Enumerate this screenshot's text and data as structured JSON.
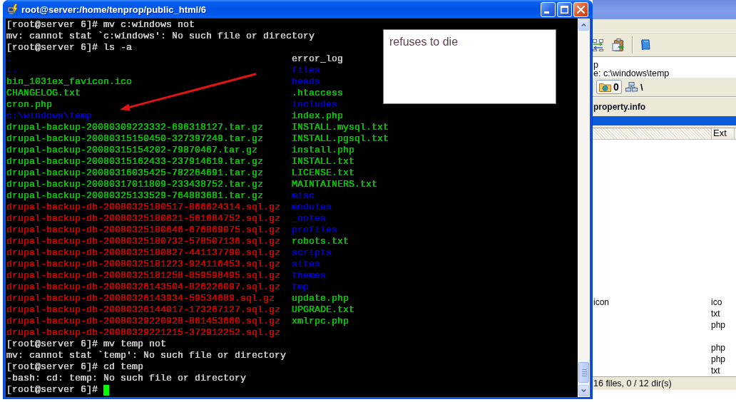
{
  "terminal": {
    "title": "root@server:/home/tenprop/public_html/6",
    "lines": [
      {
        "kind": "text",
        "text": "[root@server 6]# mv c:windows not",
        "cursor": false
      },
      {
        "kind": "text",
        "text": "mv: cannot stat `c:windows': No such file or directory",
        "cursor": false
      },
      {
        "kind": "text",
        "text": "[root@server 6]# ls -a",
        "cursor": false
      },
      {
        "kind": "listing",
        "entries": [
          {
            "text": ".",
            "color": "#0000c8"
          },
          {
            "text": "error_log",
            "color": "#c0c0c0"
          }
        ]
      },
      {
        "kind": "listing",
        "entries": [
          {
            "text": "..",
            "color": "#0000c8"
          },
          {
            "text": "files",
            "color": "#0000c8"
          }
        ]
      },
      {
        "kind": "listing",
        "entries": [
          {
            "text": "bin_1031ex_favicon.ico",
            "color": "#00c000"
          },
          {
            "text": "heads",
            "color": "#0000c8"
          }
        ]
      },
      {
        "kind": "listing",
        "entries": [
          {
            "text": "CHANGELOG.txt",
            "color": "#00c000"
          },
          {
            "text": ".htaccess",
            "color": "#00c000"
          }
        ]
      },
      {
        "kind": "listing",
        "entries": [
          {
            "text": "cron.php",
            "color": "#00c000"
          },
          {
            "text": "includes",
            "color": "#0000c8"
          }
        ]
      },
      {
        "kind": "listing",
        "entries": [
          {
            "text": "c:\\windows\\temp",
            "color": "#0000c8"
          },
          {
            "text": "index.php",
            "color": "#00c000"
          }
        ]
      },
      {
        "kind": "listing",
        "entries": [
          {
            "text": "drupal-backup-20080309223332-696318127.tar.gz",
            "color": "#00c000"
          },
          {
            "text": "INSTALL.mysql.txt",
            "color": "#00c000"
          }
        ]
      },
      {
        "kind": "listing",
        "entries": [
          {
            "text": "drupal-backup-20080315150450-327397249.tar.gz",
            "color": "#00c000"
          },
          {
            "text": "INSTALL.pgsql.txt",
            "color": "#00c000"
          }
        ]
      },
      {
        "kind": "listing",
        "entries": [
          {
            "text": "drupal-backup-20080315154202-79870467.tar.gz",
            "color": "#00c000"
          },
          {
            "text": "install.php",
            "color": "#00c000"
          }
        ]
      },
      {
        "kind": "listing",
        "entries": [
          {
            "text": "drupal-backup-20080315162433-237914619.tar.gz",
            "color": "#00c000"
          },
          {
            "text": "INSTALL.txt",
            "color": "#00c000"
          }
        ]
      },
      {
        "kind": "listing",
        "entries": [
          {
            "text": "drupal-backup-20080316035425-782264691.tar.gz",
            "color": "#00c000"
          },
          {
            "text": "LICENSE.txt",
            "color": "#00c000"
          }
        ]
      },
      {
        "kind": "listing",
        "entries": [
          {
            "text": "drupal-backup-20080317011809-233438752.tar.gz",
            "color": "#00c000"
          },
          {
            "text": "MAINTAINERS.txt",
            "color": "#00c000"
          }
        ]
      },
      {
        "kind": "listing",
        "entries": [
          {
            "text": "drupal-backup-20080325133529-764883681.tar.gz",
            "color": "#00c000"
          },
          {
            "text": "misc",
            "color": "#0000c8"
          }
        ]
      },
      {
        "kind": "listing",
        "entries": [
          {
            "text": "drupal-backup-db-20080325180517-866624314.sql.gz",
            "color": "#c80000"
          },
          {
            "text": "modules",
            "color": "#0000c8"
          }
        ]
      },
      {
        "kind": "listing",
        "entries": [
          {
            "text": "drupal-backup-db-20080325180621-561684752.sql.gz",
            "color": "#c80000"
          },
          {
            "text": "_notes",
            "color": "#0000c8"
          }
        ]
      },
      {
        "kind": "listing",
        "entries": [
          {
            "text": "drupal-backup-db-20080325180646-676869075.sql.gz",
            "color": "#c80000"
          },
          {
            "text": "profiles",
            "color": "#0000c8"
          }
        ]
      },
      {
        "kind": "listing",
        "entries": [
          {
            "text": "drupal-backup-db-20080325180732-578507136.sql.gz",
            "color": "#c80000"
          },
          {
            "text": "robots.txt",
            "color": "#00c000"
          }
        ]
      },
      {
        "kind": "listing",
        "entries": [
          {
            "text": "drupal-backup-db-20080325180827-441137790.sql.gz",
            "color": "#c80000"
          },
          {
            "text": "scripts",
            "color": "#0000c8"
          }
        ]
      },
      {
        "kind": "listing",
        "entries": [
          {
            "text": "drupal-backup-db-20080325181223-924116453.sql.gz",
            "color": "#c80000"
          },
          {
            "text": "sites",
            "color": "#0000c8"
          }
        ]
      },
      {
        "kind": "listing",
        "entries": [
          {
            "text": "drupal-backup-db-20080325181258-859598495.sql.gz",
            "color": "#c80000"
          },
          {
            "text": "themes",
            "color": "#0000c8"
          }
        ]
      },
      {
        "kind": "listing",
        "entries": [
          {
            "text": "drupal-backup-db-20080326143504-826226097.sql.gz",
            "color": "#c80000"
          },
          {
            "text": "tmp",
            "color": "#0000c8"
          }
        ]
      },
      {
        "kind": "listing",
        "entries": [
          {
            "text": "drupal-backup-db-20080326143934-59534689.sql.gz",
            "color": "#c80000"
          },
          {
            "text": "update.php",
            "color": "#00c000"
          }
        ]
      },
      {
        "kind": "listing",
        "entries": [
          {
            "text": "drupal-backup-db-20080326144017-173267127.sql.gz",
            "color": "#c80000"
          },
          {
            "text": "UPGRADE.txt",
            "color": "#00c000"
          }
        ]
      },
      {
        "kind": "listing",
        "entries": [
          {
            "text": "drupal-backup-db-20080329220928-861453660.sql.gz",
            "color": "#c80000"
          },
          {
            "text": "xmlrpc.php",
            "color": "#00c000"
          }
        ]
      },
      {
        "kind": "listing",
        "entries": [
          {
            "text": "drupal-backup-db-20080329221215-372912252.sql.gz",
            "color": "#c80000"
          }
        ]
      },
      {
        "kind": "text",
        "text": "[root@server 6]# mv temp not",
        "cursor": false
      },
      {
        "kind": "text",
        "text": "mv: cannot stat `temp': No such file or directory",
        "cursor": false
      },
      {
        "kind": "text",
        "text": "[root@server 6]# cd temp",
        "cursor": false
      },
      {
        "kind": "text",
        "text": "-bash: cd: temp: No such file or directory",
        "cursor": false
      },
      {
        "kind": "text",
        "text": "[root@server 6]#",
        "cursor": true
      }
    ]
  },
  "note": {
    "text": "refuses to die"
  },
  "file_manager": {
    "path_lines": [
      "p",
      "e: c:\\windows\\temp"
    ],
    "drive_button": {
      "label": "0"
    },
    "drive_path": "\\",
    "site": "property.info",
    "columns": [
      "Ext"
    ],
    "rows": [
      {
        "name": "icon",
        "ext": "ico"
      },
      {
        "ext": "txt"
      },
      {
        "ext": "php"
      },
      {},
      {
        "ext": "php"
      },
      {
        "ext": "php"
      },
      {
        "ext": "txt"
      }
    ],
    "status_bar": "16 files, 0 / 12 dir(s)"
  }
}
